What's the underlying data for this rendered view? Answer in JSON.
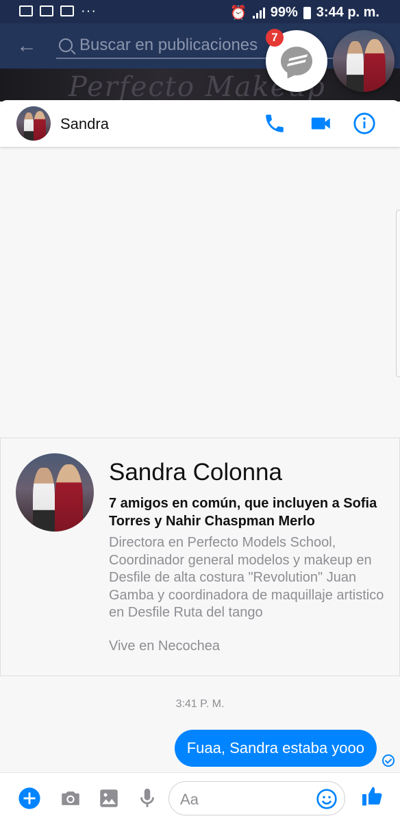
{
  "status_bar": {
    "battery": "99%",
    "time": "3:44 p. m."
  },
  "background_app": {
    "search_placeholder": "Buscar en publicaciones",
    "cover_text": "Perfecto Makeup"
  },
  "chat_heads": {
    "messenger_badge": "7"
  },
  "chat": {
    "contact_name": "Sandra",
    "profile": {
      "full_name": "Sandra Colonna",
      "mutual_friends": "7 amigos en común, que incluyen a Sofia Torres y Nahir Chaspman Merlo",
      "bio": "Directora en Perfecto Models School, Coordinador general modelos y makeup en Desfile de alta costura \"Revolution\" Juan Gamba y coordinadora de maquillaje artistico en Desfile Ruta del tango",
      "location": "Vive en Necochea"
    },
    "timestamp": "3:41 P. M.",
    "messages": [
      {
        "text": "Fuaa,  Sandra estaba yooo",
        "from": "me"
      }
    ]
  },
  "composer": {
    "placeholder": "Aa"
  },
  "colors": {
    "accent": "#0084ff",
    "header_bg": "#233559",
    "badge": "#e53935"
  },
  "icons": [
    "back-arrow-icon",
    "search-icon",
    "messenger-icon",
    "phone-icon",
    "video-icon",
    "info-icon",
    "plus-icon",
    "camera-icon",
    "image-icon",
    "microphone-icon",
    "emoji-icon",
    "thumbs-up-icon"
  ]
}
